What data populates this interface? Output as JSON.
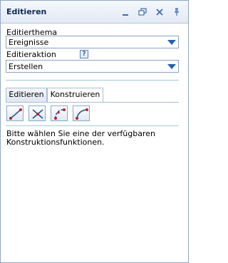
{
  "window": {
    "title": "Editieren",
    "buttons": [
      "minimize-icon",
      "restore-icon",
      "close-icon",
      "pin-icon"
    ]
  },
  "form": {
    "theme_label": "Editierthema",
    "theme_value": "Ereignisse",
    "action_label": "Editieraktion",
    "action_help": "?",
    "action_value": "Erstellen"
  },
  "tabs": [
    {
      "label": "Editieren",
      "active": false
    },
    {
      "label": "Konstruieren",
      "active": true
    }
  ],
  "tools": [
    {
      "icon": "line-segment-icon"
    },
    {
      "icon": "intersection-icon"
    },
    {
      "icon": "arc-through-points-icon"
    },
    {
      "icon": "arc-tangent-icon"
    }
  ],
  "hint_text": "Bitte wählen Sie eine der verfügbaren Konstruktionsfunktionen.",
  "colors": {
    "title_text": "#0b2a55",
    "border": "#8fa6c4",
    "accent": "#1a63b8",
    "separator": "#9fd0d6"
  }
}
